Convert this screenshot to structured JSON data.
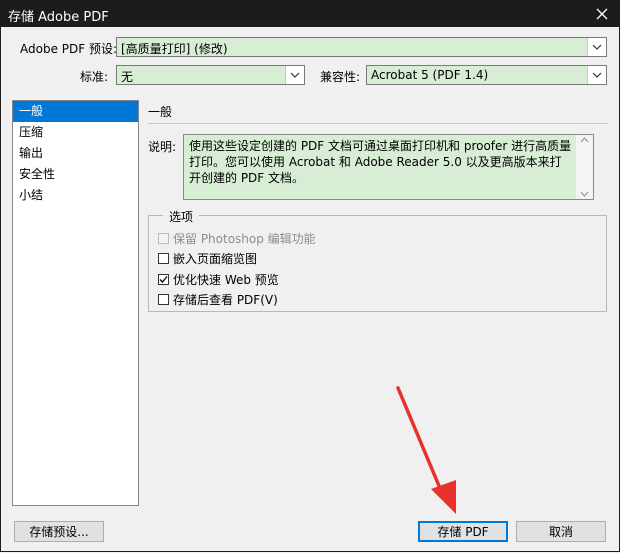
{
  "window": {
    "title": "存储 Adobe PDF"
  },
  "preset": {
    "label": "Adobe PDF 预设:",
    "value": "[高质量打印] (修改)"
  },
  "standard": {
    "label": "标准:",
    "value": "无"
  },
  "compat": {
    "label": "兼容性:",
    "value": "Acrobat 5 (PDF 1.4)"
  },
  "sidebar": {
    "items": [
      {
        "label": "一般",
        "selected": true
      },
      {
        "label": "压缩"
      },
      {
        "label": "输出"
      },
      {
        "label": "安全性"
      },
      {
        "label": "小结"
      }
    ]
  },
  "general": {
    "heading": "一般",
    "desc_label": "说明:",
    "desc_text": "使用这些设定创建的 PDF 文档可通过桌面打印机和 proofer 进行高质量打印。您可以使用 Acrobat 和 Adobe Reader 5.0 以及更高版本来打开创建的 PDF 文档。"
  },
  "options": {
    "title": "选项",
    "items": [
      {
        "label": "保留 Photoshop 编辑功能",
        "checked": false,
        "disabled": true
      },
      {
        "label": "嵌入页面缩览图",
        "checked": false,
        "disabled": false
      },
      {
        "label": "优化快速 Web 预览",
        "checked": true,
        "disabled": false
      },
      {
        "label": "存储后查看 PDF(V)",
        "checked": false,
        "disabled": false
      }
    ]
  },
  "buttons": {
    "save_preset": "存储预设...",
    "save_pdf": "存储 PDF",
    "cancel": "取消"
  },
  "icons": {
    "close": "close-icon",
    "dropdown": "chevron-down-icon",
    "check": "check-icon",
    "scroll_up": "scroll-up-icon",
    "scroll_down": "scroll-down-icon"
  },
  "colors": {
    "titlebar": "#1c1c1c",
    "field_bg": "#d7eed4",
    "selection": "#0078d7",
    "annotation_arrow": "#e8312a"
  }
}
